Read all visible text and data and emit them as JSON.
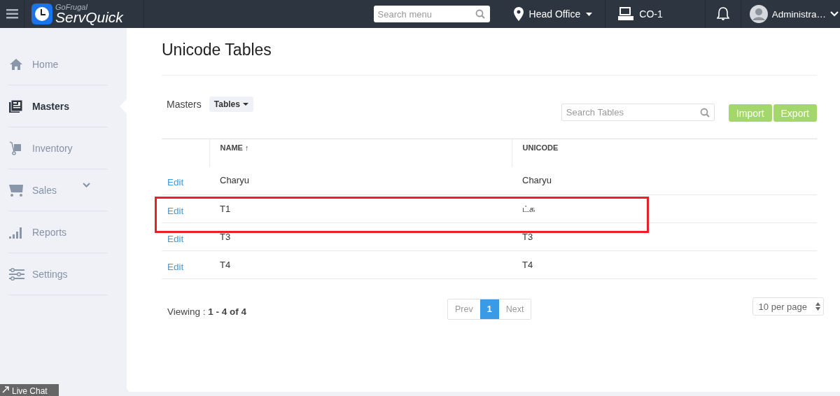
{
  "topbar": {
    "brand_small": "GoFrugal",
    "brand": "ServQuick",
    "search": {
      "placeholder": "Search menu"
    },
    "location": "Head Office",
    "counter": "CO-1",
    "user": "Administra…"
  },
  "sidebar": {
    "items": [
      {
        "label": "Home",
        "selected": false,
        "kind": "link"
      },
      {
        "label": "Masters",
        "selected": true,
        "kind": "link"
      },
      {
        "label": "Inventory",
        "selected": false,
        "kind": "link"
      },
      {
        "label": "Sales",
        "selected": false,
        "kind": "group"
      },
      {
        "label": "Reports",
        "selected": false,
        "kind": "link"
      },
      {
        "label": "Settings",
        "selected": false,
        "kind": "link"
      }
    ]
  },
  "live_chat": "Live Chat",
  "page": {
    "title": "Unicode Tables",
    "breadcrumb": "Masters",
    "dropdown": "Tables",
    "search": {
      "placeholder": "Search Tables"
    },
    "buttons": [
      "Import",
      "Export"
    ]
  },
  "table": {
    "columns": [
      "NAME",
      "UNICODE"
    ],
    "sort_mark": "↑",
    "rows": [
      {
        "action": "Edit",
        "name": "Charyu",
        "unicode": "Charyu",
        "highlighted": false
      },
      {
        "action": "Edit",
        "name": "T1",
        "unicode": "ட்க",
        "highlighted": true
      },
      {
        "action": "Edit",
        "name": "T3",
        "unicode": "T3",
        "highlighted": false
      },
      {
        "action": "Edit",
        "name": "T4",
        "unicode": "T4",
        "highlighted": false
      }
    ]
  },
  "footer": {
    "viewing_label": "Viewing : ",
    "viewing_range": "1 - 4 of 4",
    "pages": [
      {
        "label": "Prev",
        "selected": false
      },
      {
        "label": "1",
        "selected": true
      },
      {
        "label": "Next",
        "selected": false
      }
    ],
    "per_page": "10 per page"
  }
}
